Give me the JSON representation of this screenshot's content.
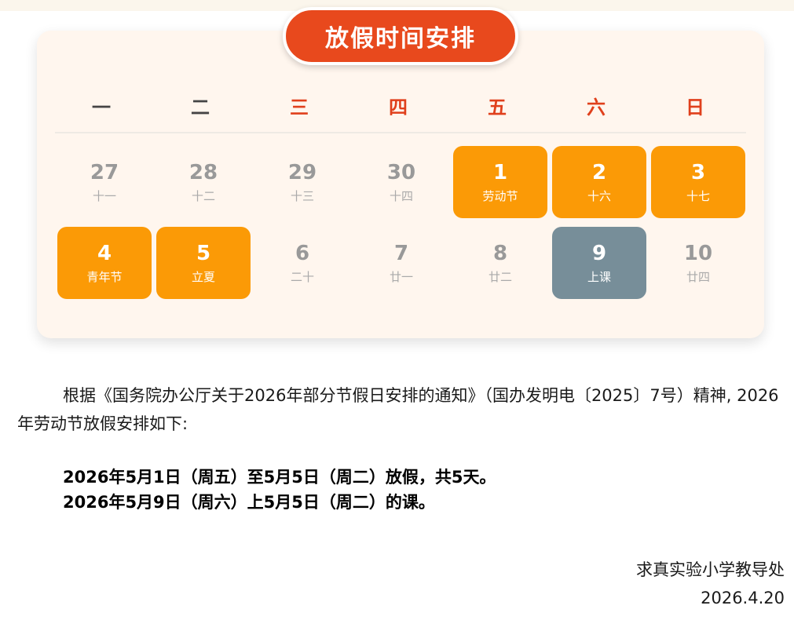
{
  "title": "放假时间安排",
  "colors": {
    "title_bg": "#e8491d",
    "holiday_bg": "#fb9a06",
    "class_bg": "#778e99",
    "weekday_dark": "#444444",
    "weekday_red": "#e0401c"
  },
  "weekdays": [
    {
      "label": "一",
      "color": "#444444"
    },
    {
      "label": "二",
      "color": "#444444"
    },
    {
      "label": "三",
      "color": "#e0401c"
    },
    {
      "label": "四",
      "color": "#e0401c"
    },
    {
      "label": "五",
      "color": "#e0401c"
    },
    {
      "label": "六",
      "color": "#e0401c"
    },
    {
      "label": "日",
      "color": "#e0401c"
    }
  ],
  "week1": [
    {
      "num": "27",
      "sub": "十一",
      "kind": "plain"
    },
    {
      "num": "28",
      "sub": "十二",
      "kind": "plain"
    },
    {
      "num": "29",
      "sub": "十三",
      "kind": "plain"
    },
    {
      "num": "30",
      "sub": "十四",
      "kind": "plain"
    },
    {
      "num": "1",
      "sub": "劳动节",
      "kind": "holiday"
    },
    {
      "num": "2",
      "sub": "十六",
      "kind": "holiday"
    },
    {
      "num": "3",
      "sub": "十七",
      "kind": "holiday"
    }
  ],
  "week2": [
    {
      "num": "4",
      "sub": "青年节",
      "kind": "holiday"
    },
    {
      "num": "5",
      "sub": "立夏",
      "kind": "holiday"
    },
    {
      "num": "6",
      "sub": "二十",
      "kind": "plain"
    },
    {
      "num": "7",
      "sub": "廿一",
      "kind": "plain"
    },
    {
      "num": "8",
      "sub": "廿二",
      "kind": "plain"
    },
    {
      "num": "9",
      "sub": "上课",
      "kind": "class"
    },
    {
      "num": "10",
      "sub": "廿四",
      "kind": "plain"
    }
  ],
  "notice": {
    "paragraph": "根据《国务院办公厅关于2026年部分节假日安排的通知》（国办发明电〔2025〕7号）精神, 2026年劳动节放假安排如下:",
    "line1": "2026年5月1日（周五）至5月5日（周二）放假，共5天。",
    "line2": "2026年5月9日（周六）上5月5日（周二）的课。",
    "issuer": "求真实验小学教导处",
    "date": "2026.4.20"
  }
}
